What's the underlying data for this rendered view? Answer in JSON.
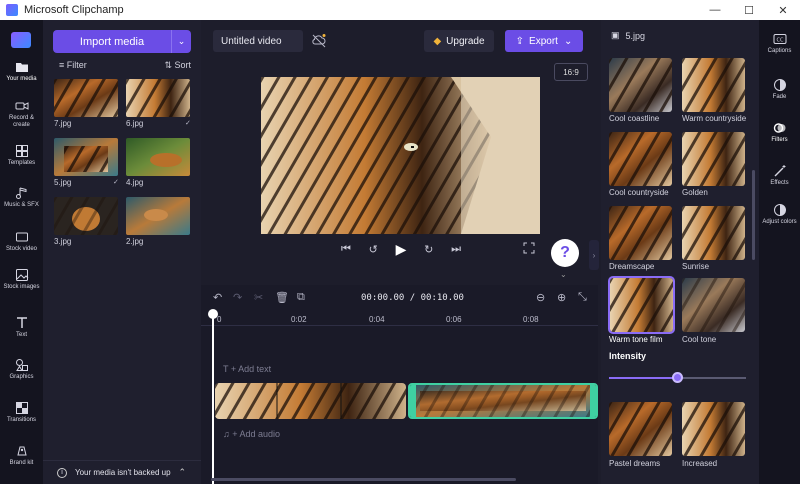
{
  "window": {
    "title": "Microsoft Clipchamp",
    "minimize": "—",
    "maximize": "☐",
    "close": "✕"
  },
  "leftnav": {
    "items": [
      {
        "label": "Your media"
      },
      {
        "label": "Record & create"
      },
      {
        "label": "Templates"
      },
      {
        "label": "Music & SFX"
      },
      {
        "label": "Stock video"
      },
      {
        "label": "Stock images"
      },
      {
        "label": "Text"
      },
      {
        "label": "Graphics"
      },
      {
        "label": "Transitions"
      },
      {
        "label": "Brand kit"
      }
    ]
  },
  "media": {
    "import_label": "Import media",
    "filter_label": "Filter",
    "sort_label": "Sort",
    "files": [
      {
        "name": "7.jpg"
      },
      {
        "name": "6.jpg",
        "checked": "✓"
      },
      {
        "name": "5.jpg",
        "checked": "✓"
      },
      {
        "name": "4.jpg"
      },
      {
        "name": "3.jpg"
      },
      {
        "name": "2.jpg"
      }
    ],
    "backup_text": "Your media isn't backed up"
  },
  "header": {
    "project_name": "Untitled video",
    "upgrade_label": "Upgrade",
    "export_label": "Export",
    "aspect_ratio": "16:9"
  },
  "player": {
    "help": "?"
  },
  "timeline": {
    "current_time": "00:00.00",
    "separator": "/",
    "total_time": "00:10.00",
    "ticks": [
      "0",
      "0:02",
      "0:04",
      "0:06",
      "0:08"
    ],
    "add_text": "+ Add text",
    "add_audio": "+ Add audio"
  },
  "filters": {
    "header": "5.jpg",
    "items": [
      {
        "name": "Cool coastline"
      },
      {
        "name": "Warm countryside"
      },
      {
        "name": "Cool countryside"
      },
      {
        "name": "Golden"
      },
      {
        "name": "Dreamscape"
      },
      {
        "name": "Sunrise"
      },
      {
        "name": "Warm tone film"
      },
      {
        "name": "Cool tone"
      },
      {
        "name": "Pastel dreams"
      },
      {
        "name": "Increased"
      }
    ],
    "intensity_label": "Intensity",
    "intensity_value": 0.5
  },
  "rightnav": {
    "items": [
      {
        "label": "Captions"
      },
      {
        "label": "Fade"
      },
      {
        "label": "Filters"
      },
      {
        "label": "Effects"
      },
      {
        "label": "Adjust colors"
      }
    ]
  },
  "colors": {
    "accent": "#6b4de6",
    "panel": "#1f1f2e",
    "rail": "#14141f"
  }
}
